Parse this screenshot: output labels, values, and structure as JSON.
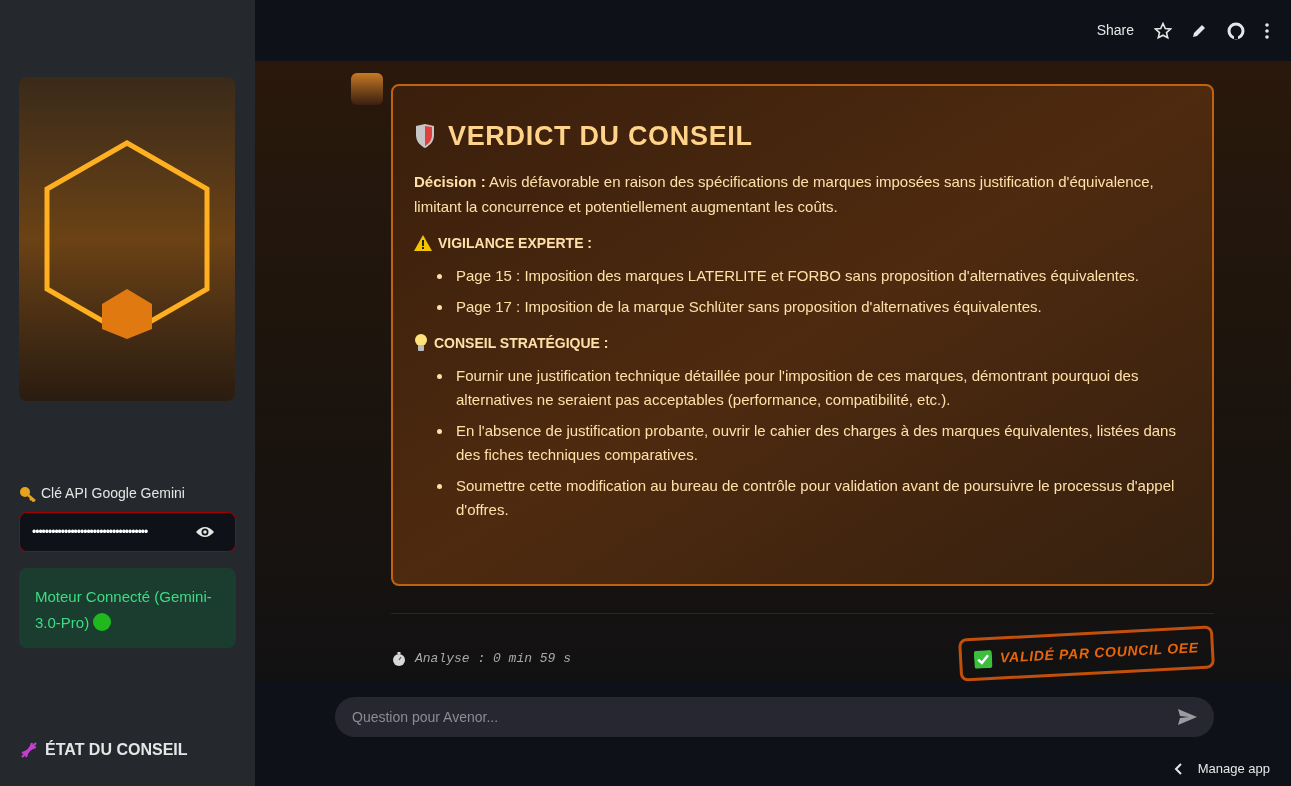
{
  "header": {
    "share": "Share"
  },
  "sidebar": {
    "api_key": {
      "label": "Clé API Google Gemini",
      "value": "••••••••••••••••••••••••••••••••••••"
    },
    "status": {
      "text": "Moteur Connecté (Gemini-3.0-Pro)",
      "connected": true
    },
    "section_title": "ÉTAT DU CONSEIL"
  },
  "message": {
    "title": "VERDICT DU CONSEIL",
    "decision": "**Décision :** Avis défavorable en raison des spécifications de marques imposées sans justification d'équivalence, limitant la concurrence et potentiellement augmentant les coûts.",
    "sections": [
      {
        "kind": "warning",
        "title": "VIGILANCE EXPERTE :",
        "items": [
          "Page 15 : Imposition des marques LATERLITE et FORBO sans proposition d'alternatives équivalentes.",
          "Page 17 : Imposition de la marque Schlüter sans proposition d'alternatives équivalentes."
        ]
      },
      {
        "kind": "idea",
        "title": "CONSEIL STRATÉGIQUE :",
        "items": [
          "Fournir une justification technique détaillée pour l'imposition de ces marques, démontrant pourquoi des alternatives ne seraient pas acceptables (performance, compatibilité, etc.).",
          "En l'absence de justification probante, ouvrir le cahier des charges à des marques équivalentes, listées dans des fiches techniques comparatives.",
          "Soumettre cette modification au bureau de contrôle pour validation avant de poursuivre le processus d'appel d'offres."
        ]
      }
    ],
    "timing": "Analyse : 0 min 59 s",
    "stamp": "VALIDÉ PAR COUNCIL OEE"
  },
  "chat_input": {
    "placeholder": "Question pour Avenor..."
  },
  "manage_app": "Manage app"
}
